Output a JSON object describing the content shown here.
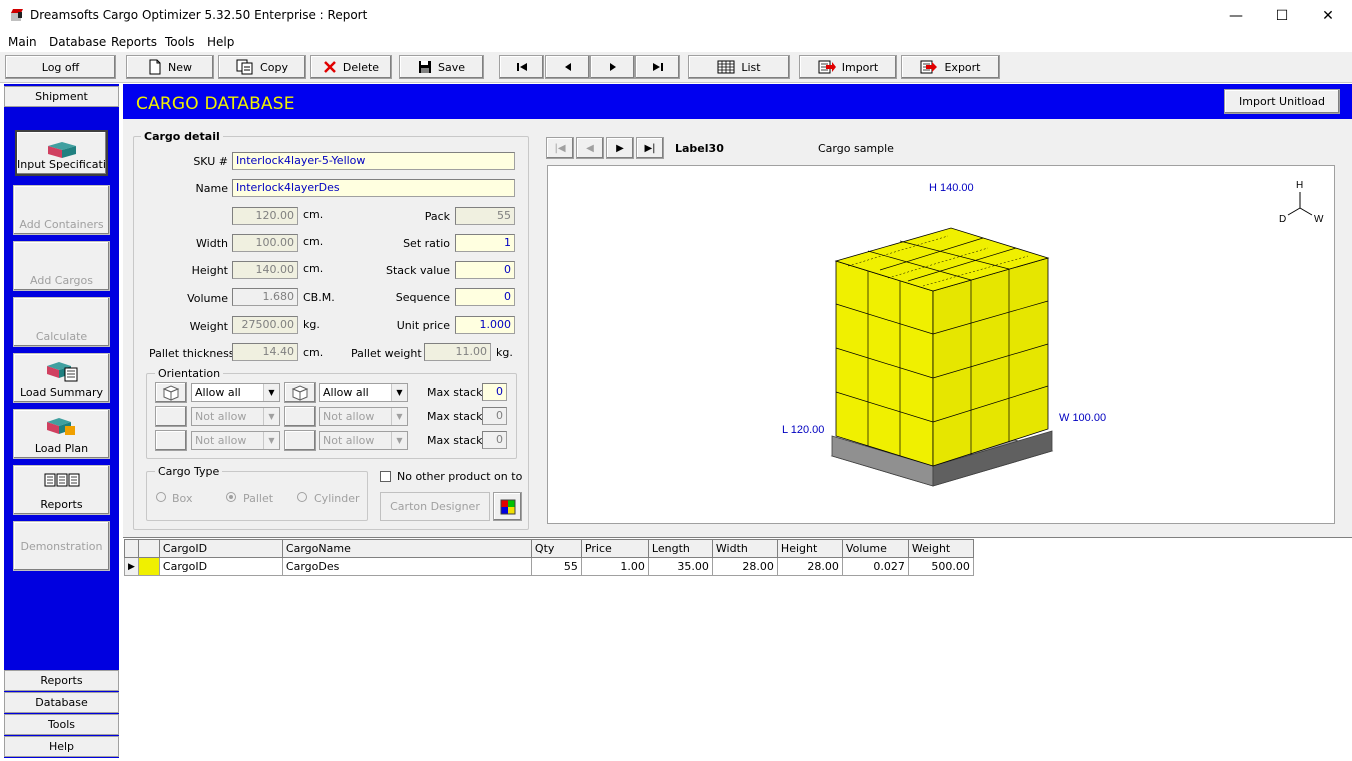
{
  "window": {
    "title": "Dreamsofts Cargo Optimizer 5.32.50 Enterprise : Report",
    "minimize": "—",
    "maximize": "☐",
    "close": "✕"
  },
  "menu": [
    "Main",
    "Database",
    "Reports",
    "Tools",
    "Help"
  ],
  "toolbar": {
    "logoff": "Log off",
    "new": "New",
    "copy": "Copy",
    "delete": "Delete",
    "save": "Save",
    "list": "List",
    "import": "Import",
    "export": "Export"
  },
  "sidebar": {
    "top": "Shipment",
    "items": [
      "Input Specification",
      "Add Containers",
      "Add Cargos",
      "Calculate",
      "Load Summary",
      "Load Plan",
      "Reports",
      "Demonstration"
    ],
    "bottom": [
      "Reports",
      "Database",
      "Tools",
      "Help"
    ]
  },
  "header": {
    "title": "CARGO DATABASE",
    "import_unitload": "Import Unitload"
  },
  "cargo_detail": {
    "group_label": "Cargo detail",
    "sku_label": "SKU #",
    "sku": "Interlock4layer-5-Yellow",
    "name_label": "Name",
    "name": "Interlock4layerDes",
    "length": "120.00",
    "unit_cm": "cm.",
    "width_label": "Width",
    "width": "100.00",
    "height_label": "Height",
    "height": "140.00",
    "volume_label": "Volume",
    "volume": "1.680",
    "unit_cbm": "CB.M.",
    "weight_label": "Weight",
    "weight": "27500.00",
    "unit_kg": "kg.",
    "pallet_thickness_label": "Pallet thickness",
    "pallet_thickness": "14.40",
    "pack_label": "Pack",
    "pack": "55",
    "set_ratio_label": "Set ratio",
    "set_ratio": "1",
    "stack_value_label": "Stack value",
    "stack_value": "0",
    "sequence_label": "Sequence",
    "sequence": "0",
    "unit_price_label": "Unit price",
    "unit_price": "1.000",
    "pallet_weight_label": "Pallet weight",
    "pallet_weight": "11.00"
  },
  "orientation": {
    "label": "Orientation",
    "rows": [
      {
        "left": "Allow all",
        "right": "Allow all",
        "max_label": "Max stack",
        "max": "0"
      },
      {
        "left": "Not allow",
        "right": "Not allow",
        "max_label": "Max stack",
        "max": "0"
      },
      {
        "left": "Not allow",
        "right": "Not allow",
        "max_label": "Max stack",
        "max": "0"
      }
    ]
  },
  "cargo_type": {
    "label": "Cargo Type",
    "box": "Box",
    "pallet": "Pallet",
    "cylinder": "Cylinder",
    "selected": "Pallet"
  },
  "no_other_product": "No other product on to",
  "carton_designer": "Carton Designer",
  "preview": {
    "nav_label": "Label30",
    "sample_label": "Cargo sample",
    "h_dim": "H 140.00",
    "l_dim": "L 120.00",
    "w_dim": "W 100.00",
    "axis_h": "H",
    "axis_d": "D",
    "axis_w": "W"
  },
  "table": {
    "headers": [
      "CargoID",
      "CargoName",
      "Qty",
      "Price",
      "Length",
      "Width",
      "Height",
      "Volume",
      "Weight"
    ],
    "rows": [
      [
        "CargoID",
        "CargoDes",
        "55",
        "1.00",
        "35.00",
        "28.00",
        "28.00",
        "0.027",
        "500.00"
      ]
    ]
  },
  "colors": {
    "header_bg": "#0000f0",
    "header_text": "#f0f000",
    "sidebar": "#0000e0",
    "box": "#f0f000"
  }
}
